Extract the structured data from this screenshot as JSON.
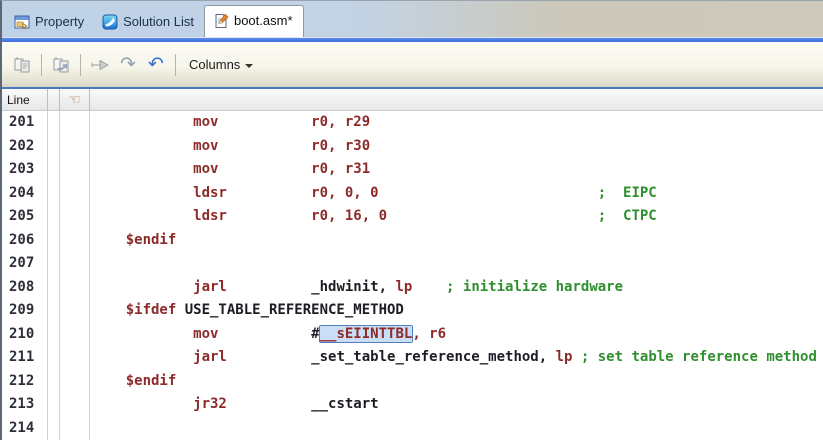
{
  "tabs": [
    {
      "label": "Property",
      "icon": "property-window-icon",
      "active": false
    },
    {
      "label": "Solution List",
      "icon": "solution-list-icon",
      "active": false
    },
    {
      "label": "boot.asm*",
      "icon": "document-edit-icon",
      "active": true
    }
  ],
  "toolbar": {
    "icons": [
      "document-pair-icon",
      "document-pair-arrow-icon",
      "forward-arrow-icon",
      "redo-icon",
      "undo-icon",
      "dropdown-arrow-icon"
    ],
    "redo_glyph": "↷",
    "undo_glyph": "↶",
    "columns_label": "Columns"
  },
  "header": {
    "line_label": "Line",
    "hand_icon": "pointing-hand-icon",
    "hand_glyph": "☜"
  },
  "editor": {
    "selected_text": "__sEIINTTBL",
    "lines": [
      {
        "num": "201",
        "segments": [
          {
            "c": "r",
            "t": "            mov           r0, r29"
          }
        ]
      },
      {
        "num": "202",
        "segments": [
          {
            "c": "r",
            "t": "            mov           r0, r30"
          }
        ]
      },
      {
        "num": "203",
        "segments": [
          {
            "c": "r",
            "t": "            mov           r0, r31"
          }
        ]
      },
      {
        "num": "204",
        "segments": [
          {
            "c": "r",
            "t": "            ldsr          r0, 0, 0                          "
          },
          {
            "c": "g",
            "t": ";  EIPC"
          }
        ]
      },
      {
        "num": "205",
        "segments": [
          {
            "c": "r",
            "t": "            ldsr          r0, 16, 0                         "
          },
          {
            "c": "g",
            "t": ";  CTPC"
          }
        ]
      },
      {
        "num": "206",
        "segments": [
          {
            "c": "r",
            "t": "    $endif"
          }
        ]
      },
      {
        "num": "207",
        "segments": []
      },
      {
        "num": "208",
        "segments": [
          {
            "c": "r",
            "t": "            jarl          "
          },
          {
            "c": "k",
            "t": "_hdwinit,"
          },
          {
            "c": "r",
            "t": " lp    "
          },
          {
            "c": "g",
            "t": "; initialize hardware"
          }
        ]
      },
      {
        "num": "209",
        "segments": [
          {
            "c": "r",
            "t": "    $ifdef "
          },
          {
            "c": "k",
            "t": "USE_TABLE_REFERENCE_METHOD"
          }
        ]
      },
      {
        "num": "210",
        "segments": [
          {
            "c": "r",
            "t": "            mov           "
          },
          {
            "c": "k",
            "t": "#"
          },
          {
            "c": "s",
            "t": "__sEIINTTBL"
          },
          {
            "c": "r",
            "t": ", r6"
          }
        ]
      },
      {
        "num": "211",
        "segments": [
          {
            "c": "r",
            "t": "            jarl          "
          },
          {
            "c": "k",
            "t": "_set_table_reference_method,"
          },
          {
            "c": "r",
            "t": " lp "
          },
          {
            "c": "g",
            "t": "; set table reference method"
          }
        ]
      },
      {
        "num": "212",
        "segments": [
          {
            "c": "r",
            "t": "    $endif"
          }
        ]
      },
      {
        "num": "213",
        "segments": [
          {
            "c": "r",
            "t": "            jr32          "
          },
          {
            "c": "k",
            "t": "__cstart"
          }
        ]
      },
      {
        "num": "214",
        "segments": []
      }
    ]
  },
  "colors": {
    "instruction": "#8d2a2a",
    "identifier": "#1c1c24",
    "comment": "#2f8f2f",
    "selection_bg": "#cadff5",
    "selection_border": "#4f7fc0",
    "tab_strip_blue": "#3d6fdd",
    "tabbar_left": "#c0d2e6",
    "tabbar_right": "#cdc9bb",
    "undo_blue": "#3a6fd0"
  }
}
